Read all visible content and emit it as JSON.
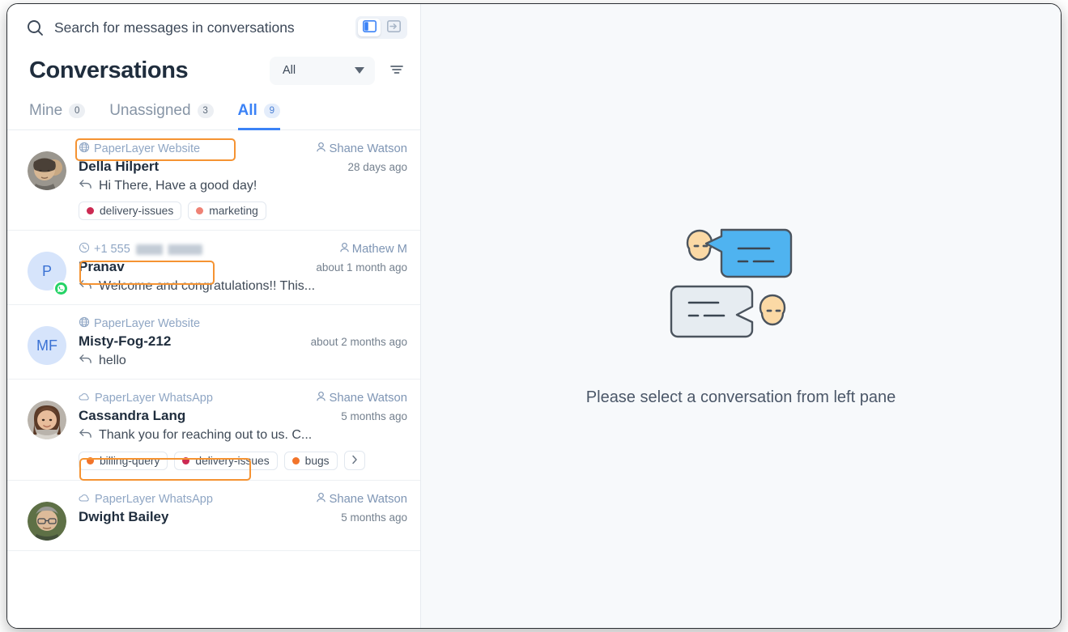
{
  "search": {
    "placeholder": "Search for messages in conversations",
    "value": "",
    "icon": "search-icon"
  },
  "layout_toggle": {
    "options": [
      {
        "name": "split-panel-layout",
        "icon": "panel-left-icon",
        "active": true
      },
      {
        "name": "expand-panel-layout",
        "icon": "panel-expand-icon",
        "active": false
      }
    ]
  },
  "header": {
    "title": "Conversations",
    "status_filter": {
      "label": "All",
      "icon": "chevron-down-icon"
    },
    "filter_button": {
      "icon": "filter-icon"
    }
  },
  "tabs": [
    {
      "label": "Mine",
      "count": "0",
      "selected": false
    },
    {
      "label": "Unassigned",
      "count": "3",
      "selected": false
    },
    {
      "label": "All",
      "count": "9",
      "selected": true
    }
  ],
  "conversations": [
    {
      "channel": "PaperLayer Website",
      "channel_icon": "globe-icon",
      "assignee": "Shane Watson",
      "assignee_icon": "user-icon",
      "name": "Della Hilpert",
      "time": "28 days ago",
      "preview": "Hi There, Have a good day!",
      "avatar_type": "photo",
      "avatar_initials": "",
      "whatsapp_badge": false,
      "tags": [
        {
          "label": "delivery-issues",
          "color": "#cc2a52"
        },
        {
          "label": "marketing",
          "color": "#ef8275"
        }
      ],
      "more_tags": false,
      "highlighted_channel": true
    },
    {
      "channel": "+1 555",
      "channel_icon": "whatsapp-outline-icon",
      "channel_redacted": true,
      "assignee": "Mathew M",
      "assignee_icon": "user-icon",
      "name": "Pranav",
      "time": "about 1 month ago",
      "preview": "Welcome and congratulations!! This...",
      "avatar_type": "initials",
      "avatar_initials": "P",
      "whatsapp_badge": true,
      "tags": [],
      "more_tags": false,
      "highlighted_channel": true
    },
    {
      "channel": "PaperLayer Website",
      "channel_icon": "globe-icon",
      "assignee": "",
      "assignee_icon": "",
      "name": "Misty-Fog-212",
      "time": "about 2 months ago",
      "preview": "hello",
      "avatar_type": "initials",
      "avatar_initials": "MF",
      "whatsapp_badge": false,
      "tags": [],
      "more_tags": false,
      "highlighted_channel": false
    },
    {
      "channel": "PaperLayer WhatsApp",
      "channel_icon": "cloud-icon",
      "assignee": "Shane Watson",
      "assignee_icon": "user-icon",
      "name": "Cassandra Lang",
      "time": "5 months ago",
      "preview": "Thank you for reaching out to us. C...",
      "avatar_type": "photo",
      "avatar_initials": "",
      "whatsapp_badge": false,
      "tags": [
        {
          "label": "billing-query",
          "color": "#f2742a"
        },
        {
          "label": "delivery-issues",
          "color": "#cc2a52"
        },
        {
          "label": "bugs",
          "color": "#f2742a"
        }
      ],
      "more_tags": true,
      "more_tags_icon": "chevron-right-icon",
      "highlighted_channel": true
    },
    {
      "channel": "PaperLayer WhatsApp",
      "channel_icon": "cloud-icon",
      "assignee": "Shane Watson",
      "assignee_icon": "user-icon",
      "name": "Dwight Bailey",
      "time": "5 months ago",
      "preview": "",
      "avatar_type": "photo",
      "avatar_initials": "",
      "whatsapp_badge": false,
      "tags": [],
      "more_tags": false,
      "highlighted_channel": false
    }
  ],
  "empty_state": {
    "message": "Please select a conversation from left pane",
    "illustration": "two-people-chat-bubbles-illustration"
  },
  "colors": {
    "accent_blue": "#3b82f6",
    "annotation_orange": "#f59332",
    "right_pane_bg": "#f7f9fb",
    "whatsapp_green": "#25d366"
  }
}
